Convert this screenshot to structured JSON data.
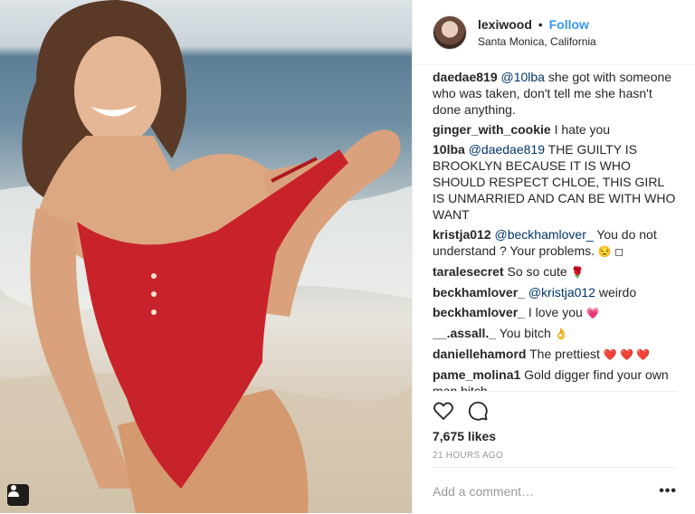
{
  "header": {
    "username": "lexiwood",
    "separator": "•",
    "follow_label": "Follow",
    "location": "Santa Monica, California"
  },
  "comments": [
    {
      "user": "daedae819",
      "mention": "@10lba",
      "text": " she got with someone who was taken, don't tell me she hasn't done anything."
    },
    {
      "user": "ginger_with_cookie",
      "mention": "",
      "text": " I hate you"
    },
    {
      "user": "10lba",
      "mention": "@daedae819",
      "text": " THE GUILTY IS BROOKLYN BECAUSE IT IS WHO SHOULD RESPECT CHLOE, THIS GIRL IS UNMARRIED AND CAN BE WITH WHO WANT"
    },
    {
      "user": "kristja012",
      "mention": "@beckhamlover_",
      "text": " You do not understand ? Your problems.",
      "emoji": "😒 ◻"
    },
    {
      "user": "taralesecret",
      "mention": "",
      "text": " So so cute",
      "emoji": "🌹"
    },
    {
      "user": "beckhamlover_",
      "mention": "@kristja012",
      "text": " weirdo"
    },
    {
      "user": "beckhamlover_",
      "mention": "",
      "text": " I love you",
      "emoji": "💗"
    },
    {
      "user": "__.assall._",
      "mention": "",
      "text": " You bitch",
      "emoji": "👌"
    },
    {
      "user": "daniellehamord",
      "mention": "",
      "text": " The prettiest",
      "emoji": "❤️ ❤️ ❤️"
    },
    {
      "user": "pame_molina1",
      "mention": "",
      "text": " Gold digger find your own man bitch"
    }
  ],
  "likes": "7,675 likes",
  "timestamp": "21 HOURS AGO",
  "comment_input": {
    "placeholder": "Add a comment…"
  },
  "more_label": "•••",
  "icons": {
    "like": "heart-icon",
    "comment": "speech-bubble-icon",
    "user_tag": "person-icon",
    "more": "ellipsis-icon"
  },
  "colors": {
    "follow": "#3897f0",
    "mention": "#003569",
    "text": "#262626",
    "muted": "#999999",
    "swimsuit": "#c8232a"
  }
}
